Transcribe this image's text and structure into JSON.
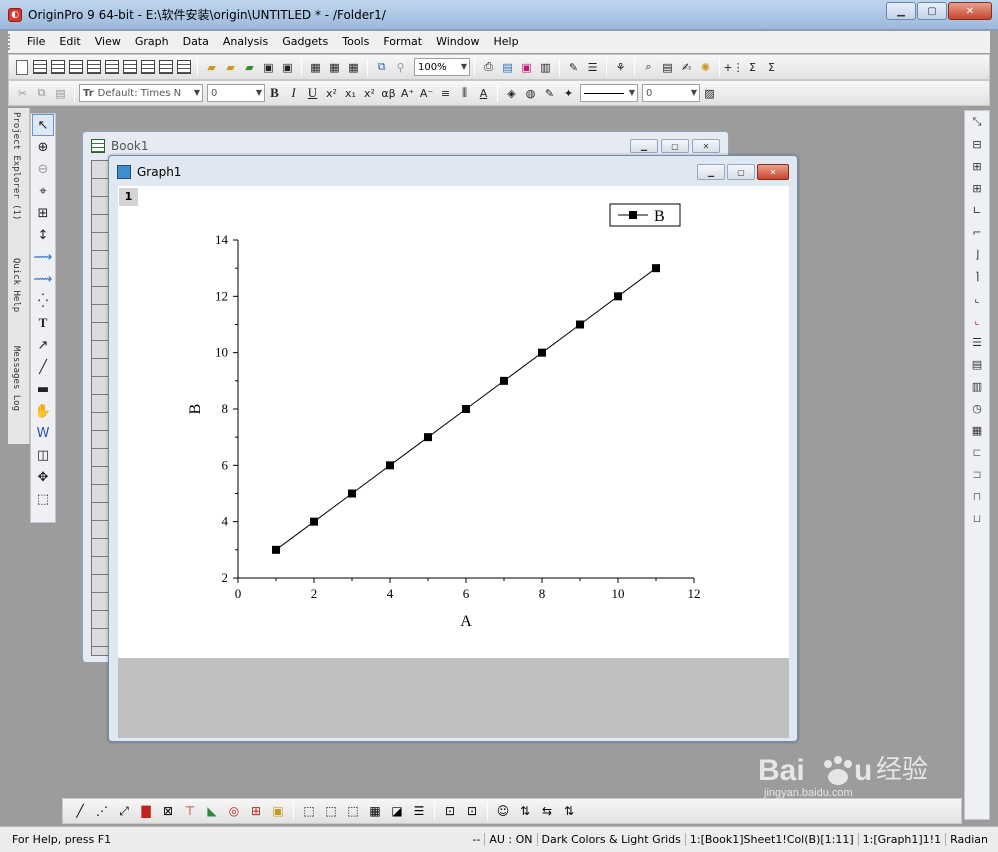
{
  "app": {
    "title": "OriginPro 9 64-bit - E:\\软件安装\\origin\\UNTITLED * - /Folder1/",
    "icon": "origin-app-icon"
  },
  "menubar": [
    "File",
    "Edit",
    "View",
    "Graph",
    "Data",
    "Analysis",
    "Gadgets",
    "Tools",
    "Format",
    "Window",
    "Help"
  ],
  "toolbar": {
    "zoom": "100%",
    "font": "Default: Times N",
    "font_size": "0",
    "line_width": "0"
  },
  "side_tabs": [
    "Project Explorer (1)",
    "Quick Help",
    "Messages Log"
  ],
  "book": {
    "title": "Book1"
  },
  "graph": {
    "title": "Graph1",
    "layer": "1"
  },
  "chart_data": {
    "type": "line",
    "series": [
      {
        "name": "B",
        "x": [
          1,
          2,
          3,
          4,
          5,
          6,
          7,
          8,
          9,
          10,
          11
        ],
        "y": [
          3,
          4,
          5,
          6,
          7,
          8,
          9,
          10,
          11,
          12,
          13
        ]
      }
    ],
    "xlabel": "A",
    "ylabel": "B",
    "xlim": [
      0,
      12
    ],
    "ylim": [
      2,
      14
    ],
    "xticks": [
      "0",
      "2",
      "4",
      "6",
      "8",
      "10",
      "12"
    ],
    "yticks": [
      "2",
      "4",
      "6",
      "8",
      "10",
      "12",
      "14"
    ],
    "legend": "top-right",
    "marker": "square",
    "grid": false
  },
  "status": {
    "help": "For Help, press F1",
    "items": [
      "--",
      "AU : ON",
      "Dark Colors & Light Grids",
      "1:[Book1]Sheet1!Col(B)[1:11]",
      "1:[Graph1]1!1",
      "Radian"
    ]
  },
  "watermark": {
    "logo": "Baidu",
    "text": "经验",
    "url": "jingyan.baidu.com"
  }
}
